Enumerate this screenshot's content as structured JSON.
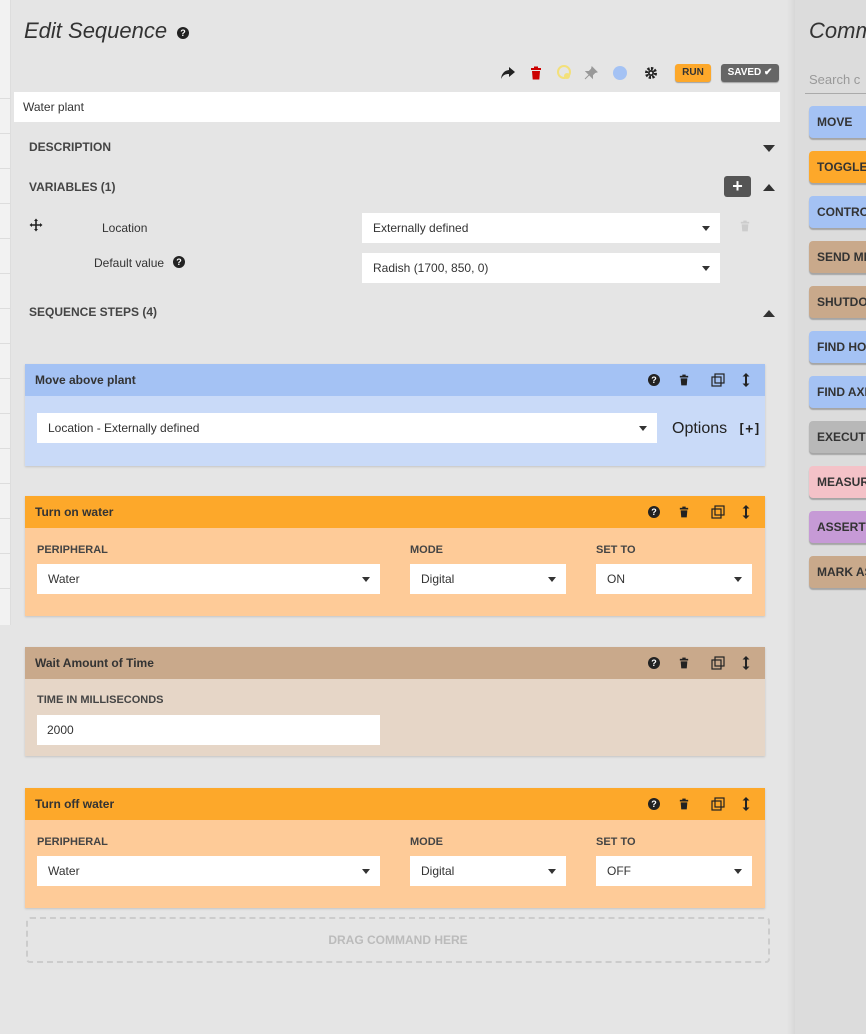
{
  "editor": {
    "title": "Edit Sequence",
    "toolbar": {
      "run_label": "RUN",
      "saved_label": "SAVED ✔"
    },
    "sequence_name": "Water plant",
    "description_header": "DESCRIPTION",
    "variables_header": "VARIABLES (1)",
    "variable": {
      "label": "Location",
      "value": "Externally defined",
      "default_label": "Default value",
      "default_value": "Radish (1700, 850, 0)"
    },
    "steps_header": "SEQUENCE STEPS (4)",
    "steps": [
      {
        "title": "Move above plant",
        "location": "Location - Externally defined",
        "options_label": "Options"
      },
      {
        "title": "Turn on water",
        "peripheral_label": "PERIPHERAL",
        "peripheral": "Water",
        "mode_label": "MODE",
        "mode": "Digital",
        "set_to_label": "SET TO",
        "set_to": "ON"
      },
      {
        "title": "Wait Amount of Time",
        "time_label": "TIME IN MILLISECONDS",
        "time": "2000"
      },
      {
        "title": "Turn off water",
        "peripheral_label": "PERIPHERAL",
        "peripheral": "Water",
        "mode_label": "MODE",
        "mode": "Digital",
        "set_to_label": "SET TO",
        "set_to": "OFF"
      }
    ],
    "drop_zone": "DRAG COMMAND HERE"
  },
  "commands_panel": {
    "title": "Comm",
    "search_placeholder": "Search c",
    "commands": [
      {
        "label": "MOVE",
        "color": "#a4c2f4"
      },
      {
        "label": "TOGGLE",
        "color": "#fda82a"
      },
      {
        "label": "CONTRO",
        "color": "#a4c2f4"
      },
      {
        "label": "SEND ME",
        "color": "#c9a98b"
      },
      {
        "label": "SHUTDOV",
        "color": "#c9a98b"
      },
      {
        "label": "FIND HO",
        "color": "#a4c2f4"
      },
      {
        "label": "FIND AXI",
        "color": "#a4c2f4"
      },
      {
        "label": "EXECUTE",
        "color": "#b8b8b8"
      },
      {
        "label": "MEASUR",
        "color": "#f4c2c8"
      },
      {
        "label": "ASSERTI",
        "color": "#c69ad6"
      },
      {
        "label": "MARK AS",
        "color": "#c9a98b"
      }
    ]
  }
}
